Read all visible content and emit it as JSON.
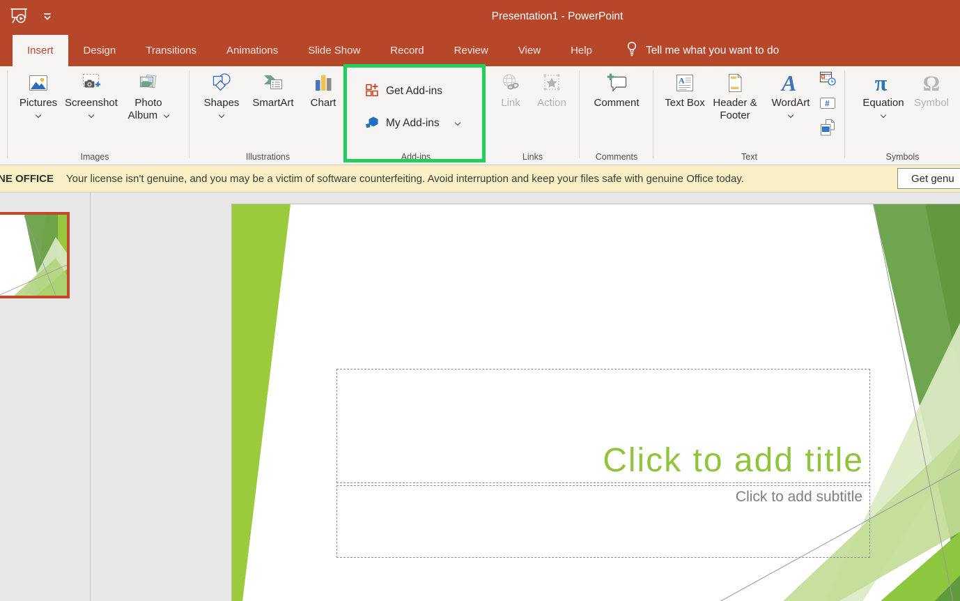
{
  "colors": {
    "titlebar_red": "#B7472A",
    "active_tab_text": "#C0472B",
    "highlight_green": "#1FD158",
    "slide_title_green": "#8FC43C",
    "license_bar_yellow": "#FAF0C5",
    "disabled_gray": "#B3B1AF",
    "thumbnail_border": "#C04A2A"
  },
  "titlebar": {
    "title": "Presentation1 - PowerPoint",
    "qat_icons": [
      "start-slideshow-icon",
      "customize-quick-access-icon"
    ]
  },
  "tabs": [
    {
      "label": "Insert",
      "active": true
    },
    {
      "label": "Design",
      "active": false
    },
    {
      "label": "Transitions",
      "active": false
    },
    {
      "label": "Animations",
      "active": false
    },
    {
      "label": "Slide Show",
      "active": false
    },
    {
      "label": "Record",
      "active": false
    },
    {
      "label": "Review",
      "active": false
    },
    {
      "label": "View",
      "active": false
    },
    {
      "label": "Help",
      "active": false
    }
  ],
  "tellme": {
    "label": "Tell me what you want to do",
    "icon": "lightbulb-icon"
  },
  "ribbon": {
    "groups": [
      {
        "label": "Images",
        "buttons": [
          {
            "label": "Pictures",
            "icon": "pictures-icon",
            "chevron": "below"
          },
          {
            "label": "Screenshot",
            "icon": "screenshot-icon",
            "chevron": "below"
          },
          {
            "label": "Photo Album",
            "icon": "photo-album-icon",
            "chevron": "inline"
          }
        ]
      },
      {
        "label": "Illustrations",
        "buttons": [
          {
            "label": "Shapes",
            "icon": "shapes-icon",
            "chevron": "below"
          },
          {
            "label": "SmartArt",
            "icon": "smartart-icon"
          },
          {
            "label": "Chart",
            "icon": "chart-icon"
          }
        ]
      },
      {
        "label": "Add-ins",
        "highlighted": true,
        "buttons": [
          {
            "label": "Get Add-ins",
            "icon": "get-addins-icon"
          },
          {
            "label": "My Add-ins",
            "icon": "my-addins-icon",
            "chevron": "inline"
          }
        ]
      },
      {
        "label": "Links",
        "buttons": [
          {
            "label": "Link",
            "icon": "link-icon",
            "disabled": true
          },
          {
            "label": "Action",
            "icon": "action-icon",
            "disabled": true
          }
        ]
      },
      {
        "label": "Comments",
        "buttons": [
          {
            "label": "Comment",
            "icon": "comment-icon"
          }
        ]
      },
      {
        "label": "Text",
        "buttons": [
          {
            "label": "Text Box",
            "icon": "text-box-icon"
          },
          {
            "label": "Header & Footer",
            "icon": "header-footer-icon"
          },
          {
            "label": "WordArt",
            "icon": "wordart-icon",
            "chevron": "below"
          }
        ],
        "small_buttons": [
          {
            "icon": "date-time-icon"
          },
          {
            "icon": "slide-number-icon"
          },
          {
            "icon": "object-icon"
          }
        ]
      },
      {
        "label": "Symbols",
        "buttons": [
          {
            "label": "Equation",
            "icon": "equation-icon",
            "chevron": "below"
          },
          {
            "label": "Symbol",
            "icon": "symbol-icon",
            "disabled": true
          }
        ]
      }
    ]
  },
  "license_bar": {
    "prefix": "NE OFFICE",
    "message": "Your license isn't genuine, and you may be a victim of software counterfeiting. Avoid interruption and keep your files safe with genuine Office today.",
    "button_label": "Get genu"
  },
  "slide": {
    "title_placeholder": "Click to add title",
    "subtitle_placeholder": "Click to add subtitle"
  }
}
